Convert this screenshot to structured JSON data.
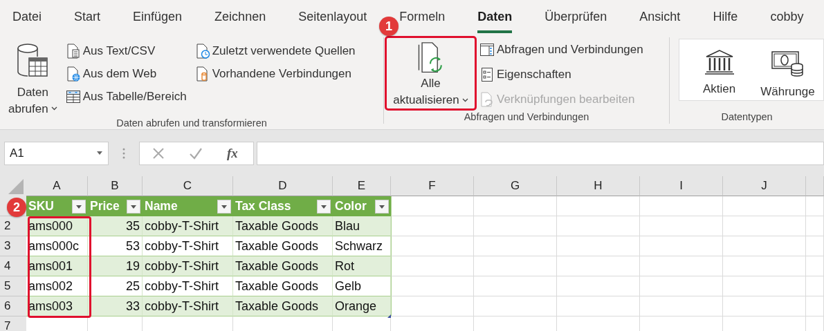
{
  "menu_tabs": [
    {
      "label": "Datei",
      "selected": false
    },
    {
      "label": "Start",
      "selected": false
    },
    {
      "label": "Einfügen",
      "selected": false
    },
    {
      "label": "Zeichnen",
      "selected": false
    },
    {
      "label": "Seitenlayout",
      "selected": false
    },
    {
      "label": "Formeln",
      "selected": false
    },
    {
      "label": "Daten",
      "selected": true
    },
    {
      "label": "Überprüfen",
      "selected": false
    },
    {
      "label": "Ansicht",
      "selected": false
    },
    {
      "label": "Hilfe",
      "selected": false
    },
    {
      "label": "cobby",
      "selected": false
    }
  ],
  "get_data_group": {
    "label": "Daten abrufen und transformieren",
    "main_button": {
      "line1": "Daten",
      "line2": "abrufen",
      "kind": "database-table"
    },
    "item_columns": [
      [
        {
          "label": "Aus Text/CSV",
          "kind": "text-file"
        },
        {
          "label": "Aus dem Web",
          "kind": "web-file"
        },
        {
          "label": "Aus Tabelle/Bereich",
          "kind": "table"
        }
      ],
      [
        {
          "label": "Zuletzt verwendete Quellen",
          "kind": "recent-file"
        },
        {
          "label": "Vorhandene Verbindungen",
          "kind": "existing-connection"
        }
      ]
    ]
  },
  "queries_group": {
    "label": "Abfragen und Verbindungen",
    "main_button": {
      "line1": "Alle",
      "line2": "aktualisieren",
      "kind": "refresh-all"
    },
    "items": [
      {
        "label": "Abfragen und Verbindungen",
        "kind": "queries-pane",
        "disabled": false
      },
      {
        "label": "Eigenschaften",
        "kind": "properties",
        "disabled": false
      },
      {
        "label": "Verknüpfungen bearbeiten",
        "kind": "edit-links",
        "disabled": true
      }
    ]
  },
  "data_types_group": {
    "label": "Datentypen",
    "buttons": [
      {
        "label": "Aktien",
        "kind": "bank"
      },
      {
        "label": "Währunge",
        "kind": "currency"
      }
    ]
  },
  "name_box": {
    "value": "A1"
  },
  "formula_bar": {
    "function_label": "fx"
  },
  "sheet": {
    "columns": [
      "A",
      "B",
      "C",
      "D",
      "E",
      "F",
      "G",
      "H",
      "I",
      "J"
    ],
    "table_columns": [
      {
        "label": "SKU",
        "numeric": false
      },
      {
        "label": "Price",
        "numeric": true
      },
      {
        "label": "Name",
        "numeric": false
      },
      {
        "label": "Tax Class",
        "numeric": false
      },
      {
        "label": "Color",
        "numeric": false
      }
    ],
    "rows": [
      {
        "number": "2",
        "banded": true,
        "cells": [
          "ams000",
          "35",
          "cobby-T-Shirt",
          "Taxable Goods",
          "Blau"
        ]
      },
      {
        "number": "3",
        "banded": false,
        "cells": [
          "ams000c",
          "53",
          "cobby-T-Shirt",
          "Taxable Goods",
          "Schwarz"
        ]
      },
      {
        "number": "4",
        "banded": true,
        "cells": [
          "ams001",
          "19",
          "cobby-T-Shirt",
          "Taxable Goods",
          "Rot"
        ]
      },
      {
        "number": "5",
        "banded": false,
        "cells": [
          "ams002",
          "25",
          "cobby-T-Shirt",
          "Taxable Goods",
          "Gelb"
        ]
      },
      {
        "number": "6",
        "banded": true,
        "cells": [
          "ams003",
          "33",
          "cobby-T-Shirt",
          "Taxable Goods",
          "Orange"
        ]
      }
    ],
    "empty_row_numbers": [
      "7"
    ]
  },
  "callouts": [
    {
      "number": "1"
    },
    {
      "number": "2"
    }
  ]
}
